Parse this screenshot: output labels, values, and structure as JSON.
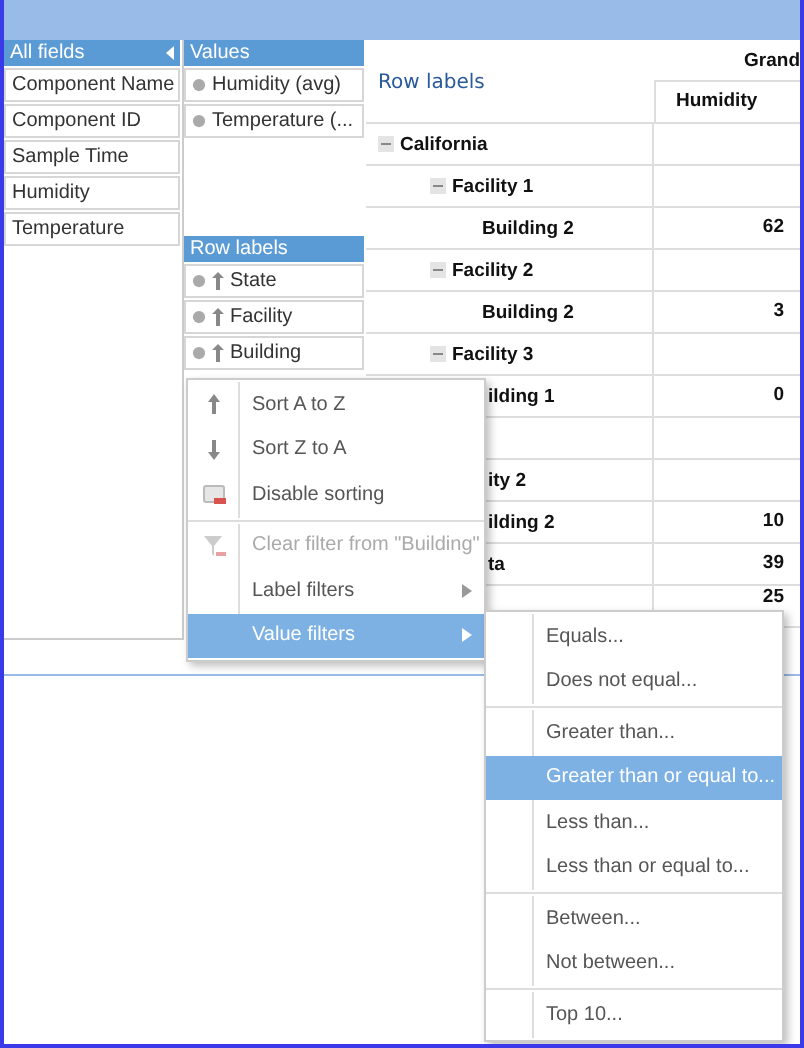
{
  "field_list": {
    "title": "All fields",
    "fields": [
      "Component Name",
      "Component ID",
      "Sample Time",
      "Humidity",
      "Temperature"
    ]
  },
  "values_area": {
    "title": "Values",
    "items": [
      "Humidity (avg)",
      "Temperature (..."
    ]
  },
  "row_labels_area": {
    "title": "Row labels",
    "items": [
      "State",
      "Facility",
      "Building"
    ]
  },
  "grid": {
    "row_header": "Row labels",
    "grand_header": "Grand",
    "value_header": "Humidity",
    "rows": [
      {
        "label": "California",
        "expanded": true,
        "partial": false,
        "children": [
          {
            "label": "Facility 1",
            "expanded": true,
            "partial": false,
            "children": [
              {
                "label": "Building 2",
                "value": "62",
                "partial": false
              }
            ]
          },
          {
            "label": "Facility 2",
            "expanded": true,
            "partial": false,
            "children": [
              {
                "label": "Building 2",
                "value": "3",
                "partial": false
              }
            ]
          },
          {
            "label": "Facility 3",
            "expanded": true,
            "partial": false,
            "children": [
              {
                "label": "ilding 1",
                "value": "0",
                "partial": true
              }
            ]
          }
        ]
      },
      {
        "partial": true,
        "children": [
          {
            "label": "ity 2",
            "partial": true,
            "children": [
              {
                "label": "ilding 2",
                "value": "10",
                "partial": true
              }
            ]
          }
        ]
      },
      {
        "label": "ta",
        "value": "39",
        "partial": true
      },
      {
        "value": "25"
      }
    ]
  },
  "context_menu": {
    "items": [
      {
        "kind": "item",
        "label": "Sort A to Z",
        "disabled": false,
        "selected": false,
        "submenu": false
      },
      {
        "kind": "item",
        "label": "Sort Z to A",
        "disabled": false,
        "selected": false,
        "submenu": false
      },
      {
        "kind": "item",
        "label": "Disable sorting",
        "disabled": false,
        "selected": false,
        "submenu": false
      },
      {
        "kind": "divider"
      },
      {
        "kind": "item",
        "label": "Clear filter from \"Building\"",
        "disabled": true,
        "selected": false,
        "submenu": false
      },
      {
        "kind": "item",
        "label": "Label filters",
        "disabled": false,
        "selected": false,
        "submenu": true
      },
      {
        "kind": "item",
        "label": "Value filters",
        "disabled": false,
        "selected": true,
        "submenu": true
      }
    ]
  },
  "submenu": {
    "items": [
      {
        "kind": "item",
        "label": "Equals...",
        "selected": false
      },
      {
        "kind": "item",
        "label": "Does not equal...",
        "selected": false
      },
      {
        "kind": "divider"
      },
      {
        "kind": "item",
        "label": "Greater than...",
        "selected": false
      },
      {
        "kind": "item",
        "label": "Greater than or equal to...",
        "selected": true
      },
      {
        "kind": "item",
        "label": "Less than...",
        "selected": false
      },
      {
        "kind": "item",
        "label": "Less than or equal to...",
        "selected": false
      },
      {
        "kind": "divider"
      },
      {
        "kind": "item",
        "label": "Between...",
        "selected": false
      },
      {
        "kind": "item",
        "label": "Not between...",
        "selected": false
      },
      {
        "kind": "divider"
      },
      {
        "kind": "item",
        "label": "Top 10...",
        "selected": false
      }
    ]
  }
}
